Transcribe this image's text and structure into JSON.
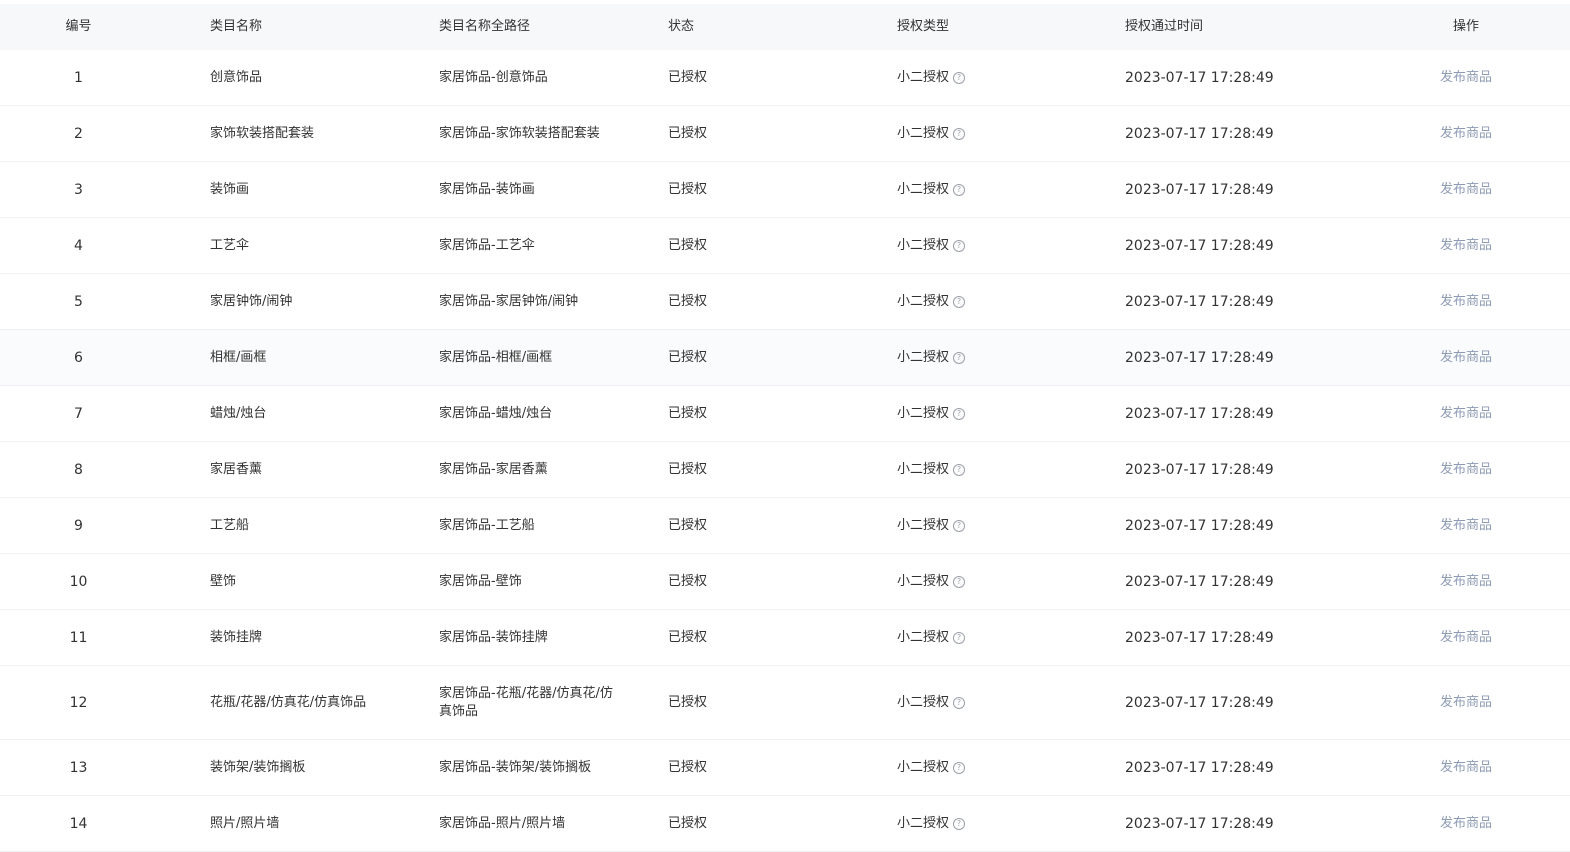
{
  "header": {
    "id": "编号",
    "name": "类目名称",
    "path": "类目名称全路径",
    "status": "状态",
    "auth_type": "授权类型",
    "auth_time": "授权通过时间",
    "op": "操作"
  },
  "icons": {
    "help": "question-circle-icon"
  },
  "colors": {
    "link": "#8e9bb4",
    "header_bg": "#f7f8fa",
    "divider": "#eef0f3"
  },
  "rows": [
    {
      "id": "1",
      "name": "创意饰品",
      "path": "家居饰品-创意饰品",
      "status": "已授权",
      "auth_type": "小二授权",
      "time": "2023-07-17 17:28:49",
      "op": "发布商品"
    },
    {
      "id": "2",
      "name": "家饰软装搭配套装",
      "path": "家居饰品-家饰软装搭配套装",
      "status": "已授权",
      "auth_type": "小二授权",
      "time": "2023-07-17 17:28:49",
      "op": "发布商品"
    },
    {
      "id": "3",
      "name": "装饰画",
      "path": "家居饰品-装饰画",
      "status": "已授权",
      "auth_type": "小二授权",
      "time": "2023-07-17 17:28:49",
      "op": "发布商品"
    },
    {
      "id": "4",
      "name": "工艺伞",
      "path": "家居饰品-工艺伞",
      "status": "已授权",
      "auth_type": "小二授权",
      "time": "2023-07-17 17:28:49",
      "op": "发布商品"
    },
    {
      "id": "5",
      "name": "家居钟饰/闹钟",
      "path": "家居饰品-家居钟饰/闹钟",
      "status": "已授权",
      "auth_type": "小二授权",
      "time": "2023-07-17 17:28:49",
      "op": "发布商品"
    },
    {
      "id": "6",
      "name": "相框/画框",
      "path": "家居饰品-相框/画框",
      "status": "已授权",
      "auth_type": "小二授权",
      "time": "2023-07-17 17:28:49",
      "op": "发布商品"
    },
    {
      "id": "7",
      "name": "蜡烛/烛台",
      "path": "家居饰品-蜡烛/烛台",
      "status": "已授权",
      "auth_type": "小二授权",
      "time": "2023-07-17 17:28:49",
      "op": "发布商品"
    },
    {
      "id": "8",
      "name": "家居香薰",
      "path": "家居饰品-家居香薰",
      "status": "已授权",
      "auth_type": "小二授权",
      "time": "2023-07-17 17:28:49",
      "op": "发布商品"
    },
    {
      "id": "9",
      "name": "工艺船",
      "path": "家居饰品-工艺船",
      "status": "已授权",
      "auth_type": "小二授权",
      "time": "2023-07-17 17:28:49",
      "op": "发布商品"
    },
    {
      "id": "10",
      "name": "壁饰",
      "path": "家居饰品-壁饰",
      "status": "已授权",
      "auth_type": "小二授权",
      "time": "2023-07-17 17:28:49",
      "op": "发布商品"
    },
    {
      "id": "11",
      "name": "装饰挂牌",
      "path": "家居饰品-装饰挂牌",
      "status": "已授权",
      "auth_type": "小二授权",
      "time": "2023-07-17 17:28:49",
      "op": "发布商品"
    },
    {
      "id": "12",
      "name": "花瓶/花器/仿真花/仿真饰品",
      "path_line1": "家居饰品-花瓶/花器/仿真花/仿",
      "path_line2": "真饰品",
      "status": "已授权",
      "auth_type": "小二授权",
      "time": "2023-07-17 17:28:49",
      "op": "发布商品"
    },
    {
      "id": "13",
      "name": "装饰架/装饰搁板",
      "path": "家居饰品-装饰架/装饰搁板",
      "status": "已授权",
      "auth_type": "小二授权",
      "time": "2023-07-17 17:28:49",
      "op": "发布商品"
    },
    {
      "id": "14",
      "name": "照片/照片墙",
      "path": "家居饰品-照片/照片墙",
      "status": "已授权",
      "auth_type": "小二授权",
      "time": "2023-07-17 17:28:49",
      "op": "发布商品"
    }
  ]
}
